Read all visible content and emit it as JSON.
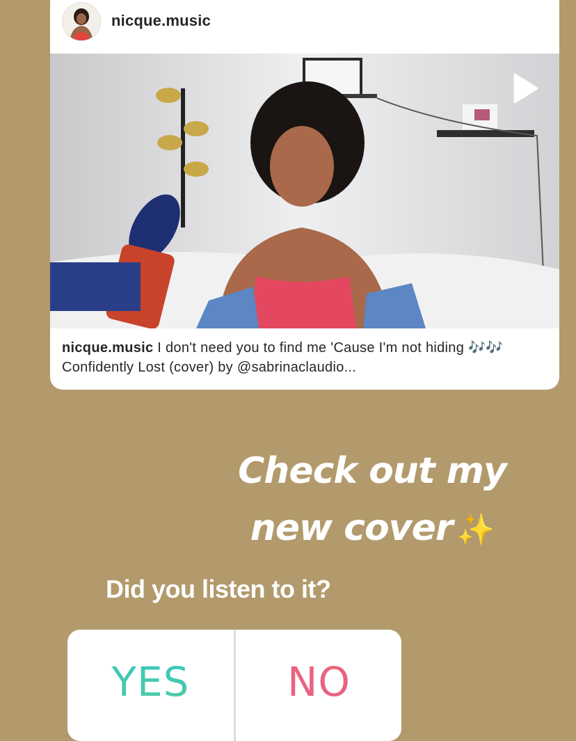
{
  "post": {
    "username": "nicque.music",
    "caption_user": "nicque.music",
    "caption_text": " I don't need you to find me 'Cause I'm not hiding 🎶🎶 Confidently Lost (cover) by @sabrinaclaudio...",
    "play_icon": "play-icon",
    "avatar_icon": "avatar"
  },
  "story": {
    "line1": "Check out my",
    "line2": "new cover",
    "sparkle": "✨"
  },
  "poll": {
    "question": "Did you listen to it?",
    "yes_label": "YES",
    "no_label": "NO"
  },
  "colors": {
    "background": "#b29a6c",
    "yes_gradient": [
      "#2fc3c6",
      "#5ad09a"
    ],
    "no_gradient": [
      "#f06a73",
      "#e55b8e"
    ]
  }
}
